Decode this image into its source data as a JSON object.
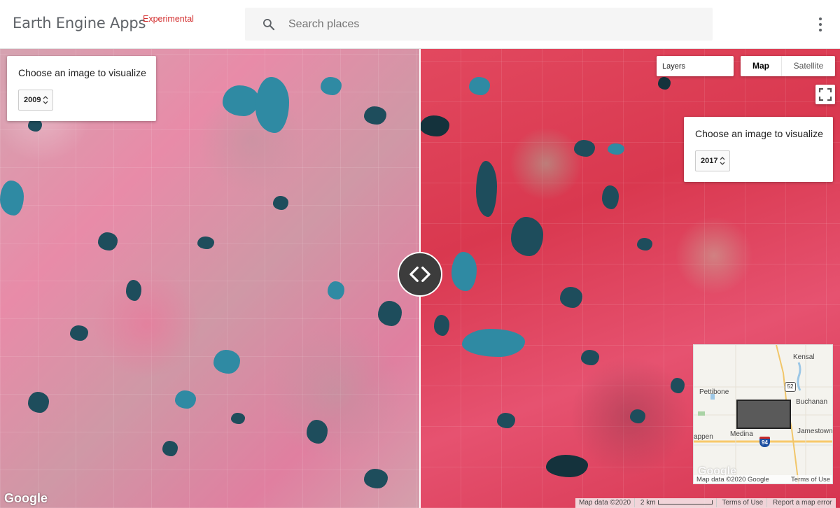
{
  "header": {
    "title": "Earth Engine Apps",
    "badge": "Experimental",
    "search_placeholder": "Search places",
    "search_icon": "search-icon",
    "menu_icon": "more-vert-icon"
  },
  "left_panel": {
    "label": "Choose an image to visualize",
    "selected_year": "2009"
  },
  "right_panel": {
    "label": "Choose an image to visualize",
    "selected_year": "2017"
  },
  "map_controls": {
    "layers_label": "Layers",
    "map_label": "Map",
    "satellite_label": "Satellite",
    "active_type": "Map",
    "fullscreen_icon": "fullscreen-icon",
    "swipe_icon": "swipe-handle-icon"
  },
  "inset_map": {
    "places": [
      "Kensal",
      "Pettibone",
      "Buchanan",
      "Jamestown",
      "Medina",
      "appen"
    ],
    "highway_shields": [
      "52",
      "94"
    ],
    "map_data": "Map data ©2020 Google",
    "terms": "Terms of Use",
    "watermark": "Google"
  },
  "attribution": {
    "logo": "Google",
    "map_data": "Map data ©2020",
    "scale": "2 km",
    "terms": "Terms of Use",
    "report": "Report a map error"
  },
  "colors": {
    "left_imagery": "#d98a9f",
    "right_imagery": "#e23c5f",
    "water": "#2f8aa3",
    "badge": "#d32f2f"
  }
}
